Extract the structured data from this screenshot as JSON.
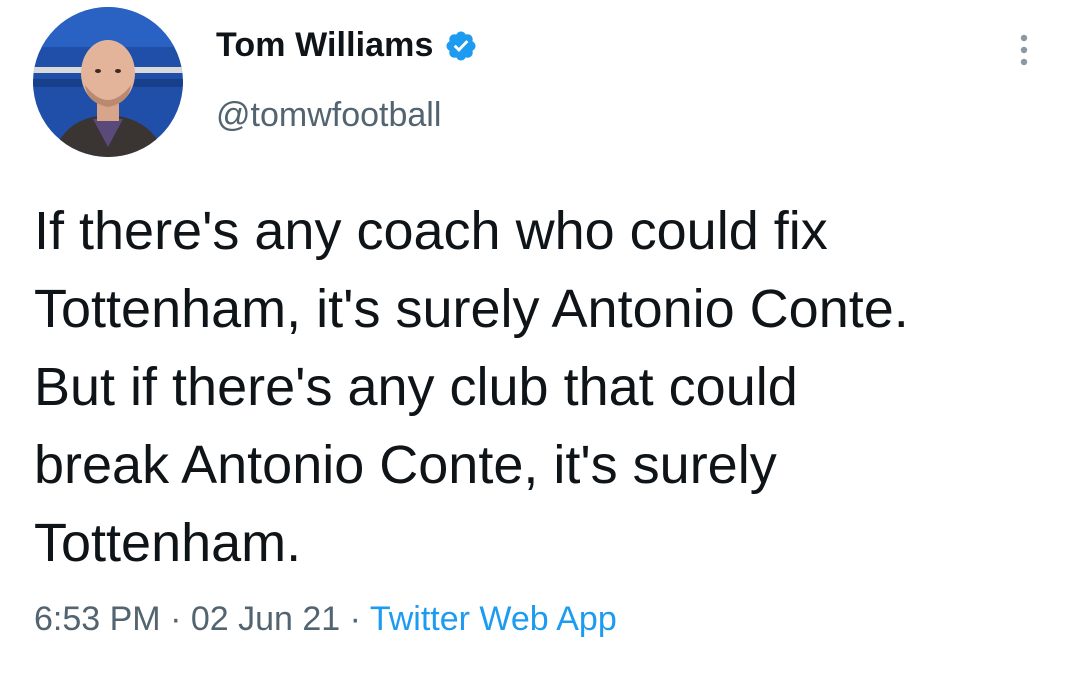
{
  "author": {
    "display_name": "Tom Williams",
    "handle": "@tomwfootball",
    "avatar_icon": "profile-photo",
    "verified_icon": "verified-badge-icon",
    "verified_color": "#1d9bf0"
  },
  "menu": {
    "more_icon": "more-vertical-icon"
  },
  "tweet": {
    "lines": [
      "If there's any coach who could fix",
      "Tottenham, it's surely Antonio Conte.",
      "But if there's any club that could",
      "break Antonio Conte, it's surely",
      "Tottenham."
    ]
  },
  "meta": {
    "time": "6:53 PM",
    "separator": " · ",
    "date": "02 Jun 21",
    "source": "Twitter Web App"
  },
  "colors": {
    "text_primary": "#0f1419",
    "text_secondary": "#536471",
    "link": "#1d9bf0"
  }
}
